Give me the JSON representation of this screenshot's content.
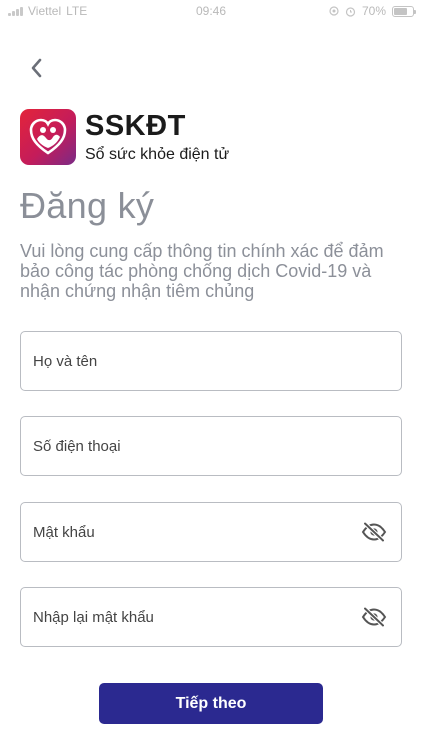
{
  "status_bar": {
    "carrier": "Viettel",
    "network": "LTE",
    "time": "09:46",
    "battery": "70%",
    "battery_level": 0.7,
    "icons": [
      "location-icon",
      "alarm-icon",
      "battery-icon"
    ]
  },
  "header": {
    "back_icon": "chevron-left-icon"
  },
  "app": {
    "name": "SSKĐT",
    "subtitle": "Sổ sức khỏe điện tử",
    "logo_icon": "heart-family-logo",
    "brand_colors": [
      "#e3243a",
      "#c41c5a",
      "#7a2a86"
    ]
  },
  "page": {
    "title": "Đăng ký",
    "description": "Vui lòng cung cấp thông tin chính xác để đảm bảo công tác phòng chống dịch Covid-19 và nhận chứng nhận tiêm chủng"
  },
  "form": {
    "full_name": {
      "placeholder": "Họ và tên",
      "value": ""
    },
    "phone": {
      "placeholder": "Số điện thoại",
      "value": ""
    },
    "password": {
      "placeholder": "Mật khẩu",
      "value": "",
      "toggle_icon": "eye-off-icon"
    },
    "confirm_password": {
      "placeholder": "Nhập lại mật khẩu",
      "value": "",
      "toggle_icon": "eye-off-icon"
    },
    "submit_label": "Tiếp theo"
  },
  "colors": {
    "primary_button": "#2b2990",
    "muted_text": "#8b8f98",
    "field_border": "#b9bcc2"
  }
}
